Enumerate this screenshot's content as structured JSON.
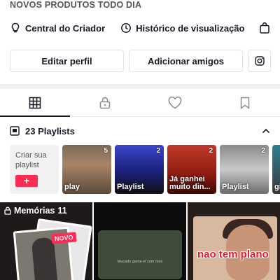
{
  "profile": {
    "bio_line": "NOVOS PRODUTOS TODO DIA",
    "links": [
      {
        "label": "Central do Criador",
        "icon": "lightbulb-icon"
      },
      {
        "label": "Histórico de visualização",
        "icon": "clock-icon"
      },
      {
        "label": "",
        "icon": "shopping-bag-icon"
      }
    ],
    "edit_profile_label": "Editar perfil",
    "add_friends_label": "Adicionar amigos",
    "instagram_icon": "instagram-icon"
  },
  "tabs": [
    {
      "icon": "grid-icon",
      "active": true
    },
    {
      "icon": "lock-icon",
      "active": false
    },
    {
      "icon": "heart-icon",
      "active": false
    },
    {
      "icon": "bookmark-icon",
      "active": false
    }
  ],
  "playlists": {
    "header_label": "23 Playlists",
    "create_label": "Criar sua playlist",
    "create_button": "+",
    "items": [
      {
        "name": "play",
        "count": "5"
      },
      {
        "name": "Playlist",
        "count": "2"
      },
      {
        "name": "Já ganhei muito din...",
        "count": "2"
      },
      {
        "name": "Playlist",
        "count": "2"
      },
      {
        "name": "gi c",
        "count": ""
      }
    ]
  },
  "videos": {
    "memories_label": "Memórias",
    "memories_count": "11",
    "new_badge": "NOVO",
    "cell2_caption": "Mucado gama el com mes",
    "cell3_overlay": "nao tem plano"
  },
  "colors": {
    "accent": "#fe2c55",
    "text": "#161823"
  }
}
